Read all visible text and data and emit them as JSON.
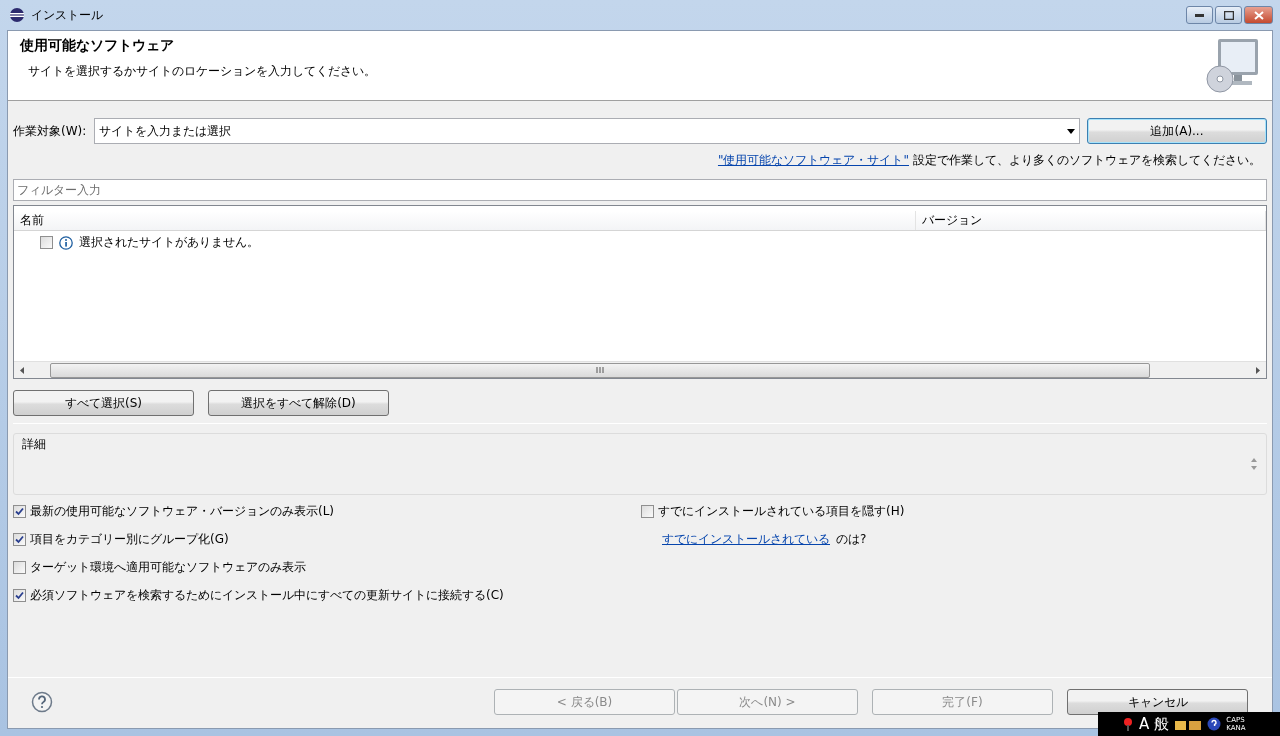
{
  "window": {
    "title": "インストール"
  },
  "header": {
    "title": "使用可能なソフトウェア",
    "description": "サイトを選択するかサイトのロケーションを入力してください。"
  },
  "work_with": {
    "label": "作業対象(W):",
    "value": "サイトを入力または選択",
    "add_button": "追加(A)..."
  },
  "sites_hint": {
    "link": "\"使用可能なソフトウェア・サイト\"",
    "text": "設定で作業して、より多くのソフトウェアを検索してください。"
  },
  "filter": {
    "placeholder": "フィルター入力"
  },
  "table": {
    "columns": [
      "名前",
      "バージョン"
    ],
    "rows": [
      {
        "checked": false,
        "name": "選択されたサイトがありません。"
      }
    ]
  },
  "selection_buttons": [
    "すべて選択(S)",
    "選択をすべて解除(D)"
  ],
  "details": {
    "label": "詳細"
  },
  "options": [
    {
      "label": "最新の使用可能なソフトウェア・バージョンのみ表示(L)",
      "checked": true
    },
    {
      "label": "項目をカテゴリー別にグループ化(G)",
      "checked": true
    },
    {
      "label": "ターゲット環境へ適用可能なソフトウェアのみ表示",
      "checked": false
    },
    {
      "label": "必須ソフトウェアを検索するためにインストール中にすべての更新サイトに接続する(C)",
      "checked": true
    }
  ],
  "hide_installed": {
    "label": "すでにインストールされている項目を隠す(H)",
    "checked": false
  },
  "installed_hint": {
    "link": "すでにインストールされている",
    "text": "のは?"
  },
  "footer_buttons": [
    {
      "label": "< 戻る(B)",
      "disabled": true
    },
    {
      "label": "次へ(N) >",
      "disabled": true
    },
    {
      "label": "完了(F)",
      "disabled": true
    },
    {
      "label": "キャンセル",
      "disabled": false
    }
  ],
  "ime_bar": {
    "mode": "A",
    "label": "般",
    "caps": "CAPS",
    "kana": "KANA"
  }
}
